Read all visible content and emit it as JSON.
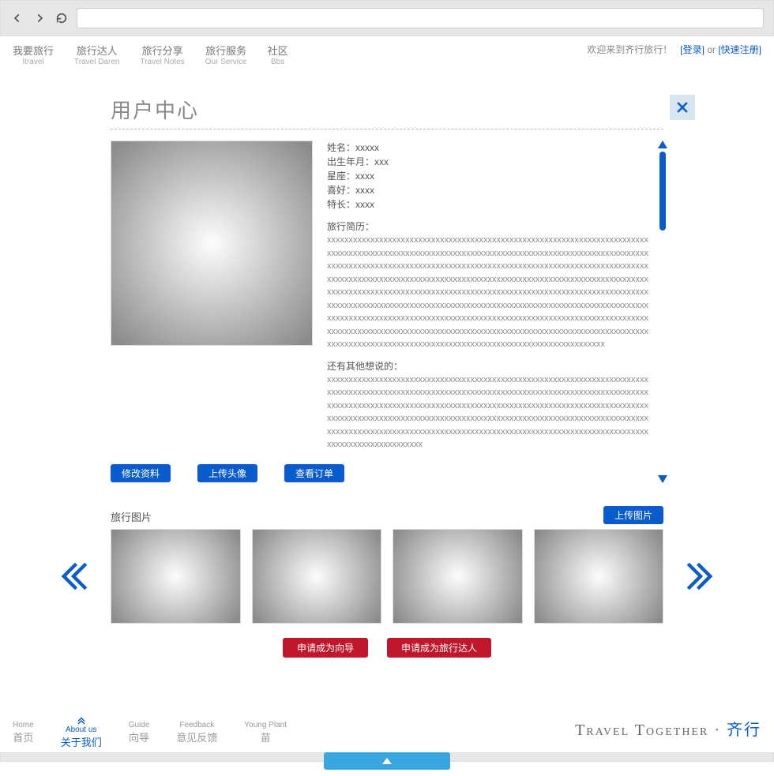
{
  "top_nav": [
    {
      "cn": "我要旅行",
      "en": "Itravel"
    },
    {
      "cn": "旅行达人",
      "en": "Travel Daren"
    },
    {
      "cn": "旅行分享",
      "en": "Travel Notes"
    },
    {
      "cn": "旅行服务",
      "en": "Our Service"
    },
    {
      "cn": "社区",
      "en": "Bbs"
    }
  ],
  "top_right": {
    "welcome": "欢迎来到齐行旅行！",
    "login": "[登录]",
    "or": "or",
    "register": "[快速注册]"
  },
  "page_title": "用户中心",
  "profile": {
    "name_label": "姓名：",
    "name": "xxxxx",
    "birth_label": "出生年月：",
    "birth": "xxx",
    "zodiac_label": "星座：",
    "zodiac": "xxxx",
    "hobby_label": "喜好：",
    "hobby": "xxxx",
    "skill_label": "特长：",
    "skill": "xxxx",
    "bio_label": "旅行简历：",
    "bio": "xxxxxxxxxxxxxxxxxxxxxxxxxxxxxxxxxxxxxxxxxxxxxxxxxxxxxxxxxxxxxxxxxxxxxxxxxxxxxxxxxxxxxxxxxxxxxxxxxxxxxxxxxxxxxxxxxxxxxxxxxxxxxxxxxxxxxxxxxxxxxxxxxxxxxxxxxxxxxxxxxxxxxxxxxxxxxxxxxxxxxxxxxxxxxxxxxxxxxxxxxxxxxxxxxxxxxxxxxxxxxxxxxxxxxxxxxxxxxxxxxxxxxxxxxxxxxxxxxxxxxxxxxxxxxxxxxxxxxxxxxxxxxxxxxxxxxxxxxxxxxxxxxxxxxxxxxxxxxxxxxxxxxxxxxxxxxxxxxxxxxxxxxxxxxxxxxxxxxxxxxxxxxxxxxxxxxxxxxxxxxxxxxxxxxxxxxxxxxxxxxxxxxxxxxxxxxxxxxxxxxxxxxxxxxxxxxxxxxxxxxxxxxxxxxxxxxxxxxxxxxxxxxxxxxxxxxxxxxxxxxxxxxxxxxxxxxxxxxxxxxxxxxxxxxxxxxxxxxxxxxxxxxxxxxxxxxxxxxxxxxxxxxxxxxxxxxxxxxxxxxxxxxxxxxxxxxxxxxxxxxxxxxxxxxxxxxxxxxxxxxxxxxxxxxxxxxxxxxxxxxxxxxxxxxxxxxxxxxxxxxxxxxxxxxxxxxxxx",
    "other_label": "还有其他想说的：",
    "other": "xxxxxxxxxxxxxxxxxxxxxxxxxxxxxxxxxxxxxxxxxxxxxxxxxxxxxxxxxxxxxxxxxxxxxxxxxxxxxxxxxxxxxxxxxxxxxxxxxxxxxxxxxxxxxxxxxxxxxxxxxxxxxxxxxxxxxxxxxxxxxxxxxxxxxxxxxxxxxxxxxxxxxxxxxxxxxxxxxxxxxxxxxxxxxxxxxxxxxxxxxxxxxxxxxxxxxxxxxxxxxxxxxxxxxxxxxxxxxxxxxxxxxxxxxxxxxxxxxxxxxxxxxxxxxxxxxxxxxxxxxxxxxxxxxxxxxxxxxxxxxxxxxxxxxxxxxxxxxxxxxxxxxxxxxxxxxxxxxxxxxxxxxxxxxxxxxxxxxxxxxxxxxxxxxxxxxxxxxxxxxxxxxxxxxxxx"
  },
  "buttons": {
    "edit": "修改资料",
    "upload_avatar": "上传头像",
    "orders": "查看订单",
    "upload_photo": "上传图片"
  },
  "gallery_title": "旅行图片",
  "apply": {
    "guide": "申请成为向导",
    "daren": "申请成为旅行达人"
  },
  "footer_nav": [
    {
      "en": "Home",
      "cn": "首页"
    },
    {
      "en": "About us",
      "cn": "关于我们"
    },
    {
      "en": "Guide",
      "cn": "向导"
    },
    {
      "en": "Feedback",
      "cn": "意见反馈"
    },
    {
      "en": "Young Plant",
      "cn": "苗"
    }
  ],
  "brand": {
    "en": "Travel Together",
    "dot": " · ",
    "cn": "齐行"
  }
}
